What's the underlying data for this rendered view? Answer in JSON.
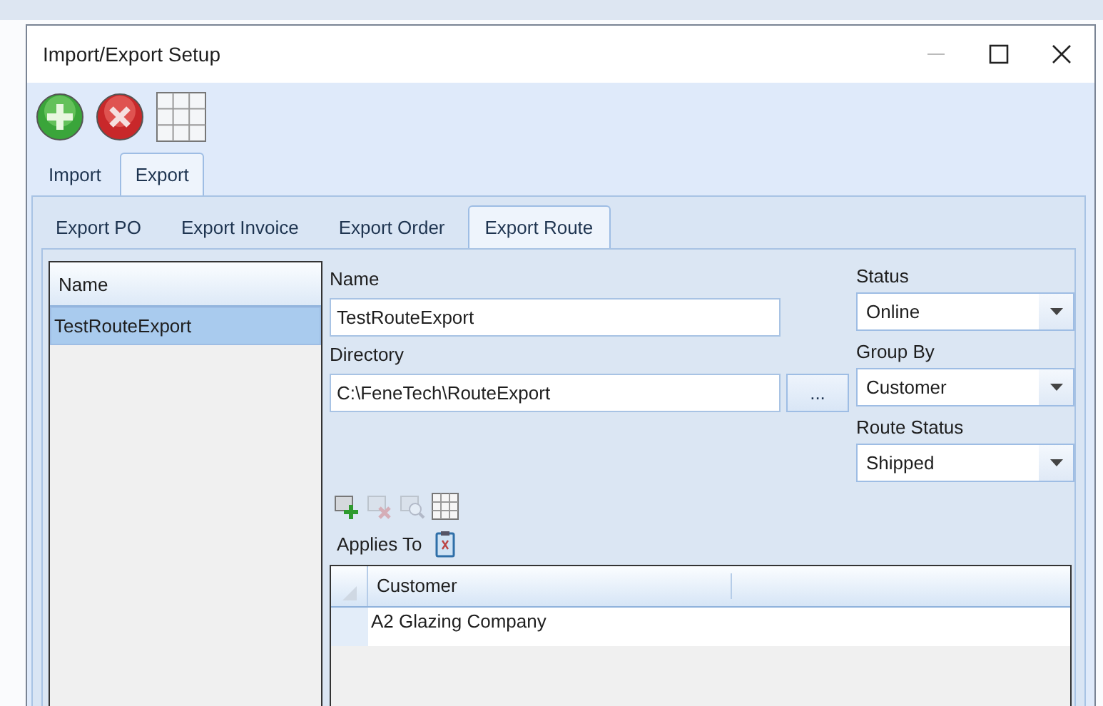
{
  "window": {
    "title": "Import/Export Setup"
  },
  "toolbar": [
    {
      "kind": "add"
    },
    {
      "kind": "delete"
    },
    {
      "kind": "grid"
    }
  ],
  "tabs": [
    {
      "label": "Import",
      "selected": false
    },
    {
      "label": "Export",
      "selected": true
    }
  ],
  "sub_tabs": [
    {
      "label": "Export PO",
      "selected": false
    },
    {
      "label": "Export Invoice",
      "selected": false
    },
    {
      "label": "Export Order",
      "selected": false
    },
    {
      "label": "Export Route",
      "selected": true
    }
  ],
  "list": {
    "header": "Name",
    "rows": [
      {
        "text": "TestRouteExport",
        "selected": true
      }
    ]
  },
  "form": {
    "name_label": "Name",
    "name_value": "TestRouteExport",
    "directory_label": "Directory",
    "directory_value": "C:\\FeneTech\\RouteExport",
    "browse_button": "...",
    "dropdowns": [
      {
        "label": "Status",
        "value": "Online"
      },
      {
        "label": "Group By",
        "value": "Customer"
      },
      {
        "label": "Route Status",
        "value": "Shipped"
      }
    ]
  },
  "grid_toolbar": [
    {
      "kind": "add",
      "disabled": false
    },
    {
      "kind": "delete",
      "disabled": true
    },
    {
      "kind": "search",
      "disabled": true
    },
    {
      "kind": "grid",
      "disabled": false
    }
  ],
  "applies_to": {
    "label": "Applies To"
  },
  "grid": {
    "columns": [
      "Customer"
    ],
    "rows": [
      [
        "A2 Glazing Company"
      ]
    ]
  }
}
